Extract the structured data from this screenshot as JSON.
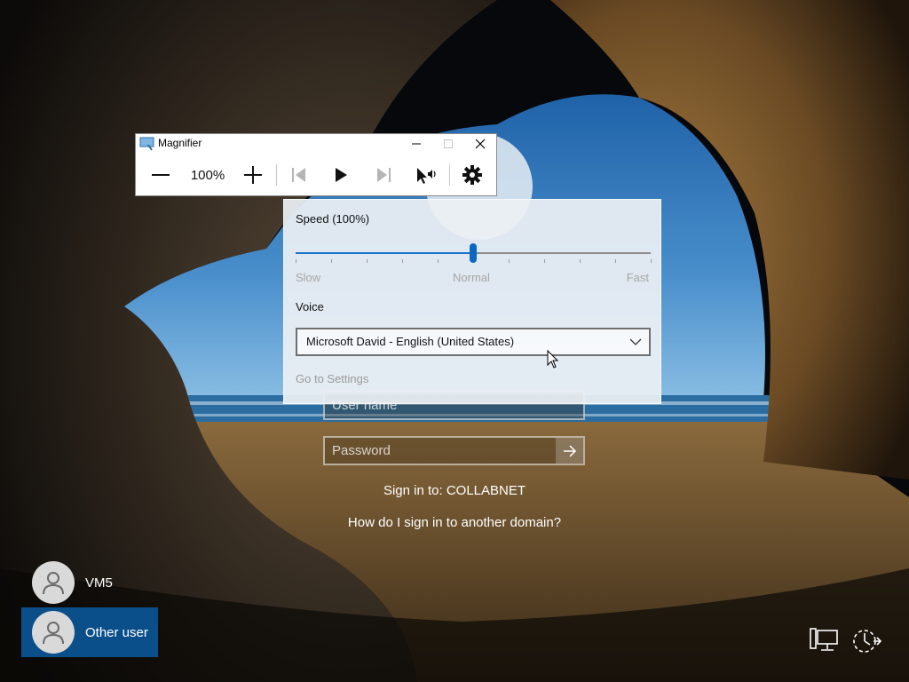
{
  "login": {
    "username_placeholder": "User name",
    "password_placeholder": "Password",
    "sign_in_to": "Sign in to: COLLABNET",
    "another_domain": "How do I sign in to another domain?"
  },
  "users": [
    {
      "name": "VM5",
      "selected": false
    },
    {
      "name": "Other user",
      "selected": true
    }
  ],
  "tray_icons": [
    "network-icon",
    "ease-of-access-icon"
  ],
  "magnifier": {
    "title": "Magnifier",
    "zoom_level": "100%",
    "icons": [
      "zoom-out-icon",
      "zoom-in-icon",
      "previous-icon",
      "play-icon",
      "next-icon",
      "read-from-pointer-icon",
      "gear-icon"
    ]
  },
  "reading_settings": {
    "speed_label": "Speed (100%)",
    "speed_fraction": 0.5,
    "slider_ticks": 11,
    "slider_labels": {
      "slow": "Slow",
      "normal": "Normal",
      "fast": "Fast"
    },
    "voice_label": "Voice",
    "voice_value": "Microsoft David - English (United States)",
    "go_to_settings": "Go to Settings"
  },
  "colors": {
    "accent": "#0a67c2",
    "selected_user_bg": "#0b4f8a",
    "sea": "#2b6da0"
  }
}
